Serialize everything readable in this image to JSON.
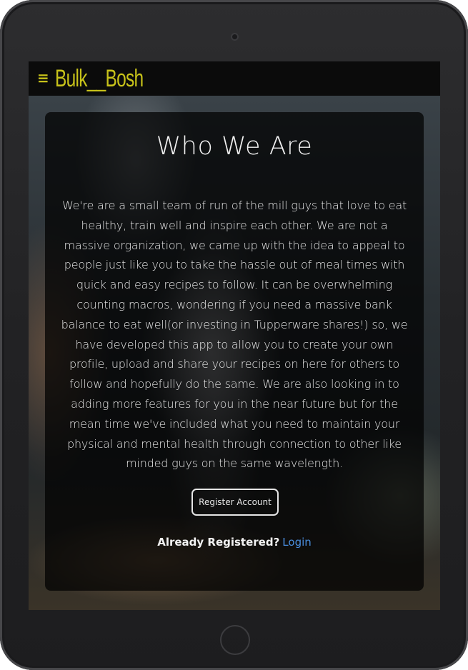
{
  "navbar": {
    "menu_icon": "≡",
    "brand": "Bulk__Bosh",
    "accent_color": "#c7c21a"
  },
  "about": {
    "title": "Who We Are",
    "body": "We're are a small team of run of the mill guys that love to eat healthy, train well and inspire each other. We are not a massive organization, we came up with the idea to appeal to people just like you to take the hassle out of meal times with quick and easy recipes to follow. It can be overwhelming counting macros, wondering if you need a massive bank balance to eat well(or investing in Tupperware shares!) so, we have developed this app to allow you to create your own profile, upload and share your recipes on here for others to follow and hopefully do the same. We are also looking in to adding more features for you in the near future but for the mean time we've included what you need to maintain your physical and mental health through connection to other like minded guys on the same wavelength."
  },
  "actions": {
    "register_label": "Register Account",
    "already_registered": "Already Registered?",
    "login_label": "Login",
    "link_color": "#4a8fe0"
  },
  "icons": {
    "menu": "hamburger-menu-icon",
    "camera": "front-camera",
    "home": "home-button"
  }
}
